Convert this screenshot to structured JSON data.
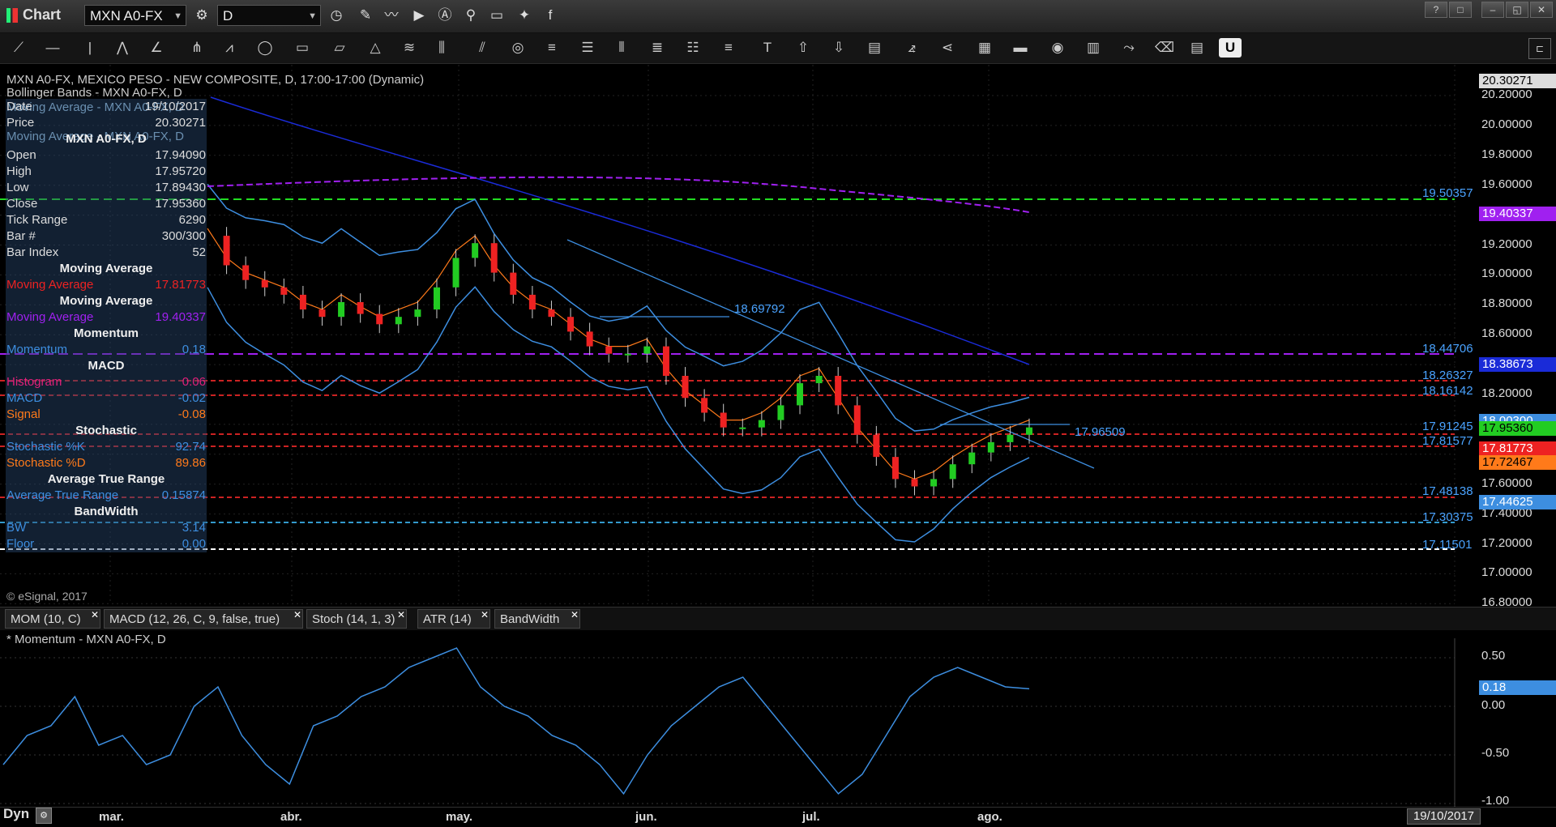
{
  "app": {
    "title": "Chart"
  },
  "toolbar": {
    "symbol": "MXN A0-FX",
    "interval": "D"
  },
  "window_buttons": [
    "?",
    "□",
    "–",
    "◱",
    "✕"
  ],
  "chart": {
    "title": "MXN A0-FX, MEXICO PESO - NEW COMPOSITE, D, 17:00-17:00 (Dynamic)",
    "bands_label": "Bollinger Bands - MXN A0-FX, D",
    "ma1_label": "Moving Average - MXN A0-FX, D",
    "ma2_label": "Moving Average - MXN A0-FX, D",
    "copyright": "© eSignal, 2017"
  },
  "info_panel": {
    "date": {
      "label": "Date",
      "value": "19/10/2017"
    },
    "price": {
      "label": "Price",
      "value": "20.30271"
    },
    "symbol_header": "MXN A0-FX, D",
    "open": {
      "label": "Open",
      "value": "17.94090"
    },
    "high": {
      "label": "High",
      "value": "17.95720"
    },
    "low": {
      "label": "Low",
      "value": "17.89430"
    },
    "close": {
      "label": "Close",
      "value": "17.95360"
    },
    "tick_range": {
      "label": "Tick Range",
      "value": "6290"
    },
    "bar_num": {
      "label": "Bar #",
      "value": "300/300"
    },
    "bar_index": {
      "label": "Bar Index",
      "value": "52"
    },
    "ma1_header": "Moving Average",
    "ma1": {
      "label": "Moving Average",
      "value": "17.81773"
    },
    "ma2_header": "Moving Average",
    "ma2": {
      "label": "Moving Average",
      "value": "19.40337"
    },
    "mom_header": "Momentum",
    "mom": {
      "label": "Momentum",
      "value": "0.18"
    },
    "macd_header": "MACD",
    "hist": {
      "label": "Histogram",
      "value": "0.06"
    },
    "macd": {
      "label": "MACD",
      "value": "-0.02"
    },
    "signal": {
      "label": "Signal",
      "value": "-0.08"
    },
    "stoch_header": "Stochastic",
    "stk": {
      "label": "Stochastic %K",
      "value": "92.74"
    },
    "std": {
      "label": "Stochastic %D",
      "value": "89.86"
    },
    "atr_header": "Average True Range",
    "atr": {
      "label": "Average True Range",
      "value": "0.15874"
    },
    "bw_header": "BandWidth",
    "bw": {
      "label": "BW",
      "value": "3.14"
    },
    "floor": {
      "label": "Floor",
      "value": "0.00"
    }
  },
  "price_axis": [
    "20.20000",
    "20.00000",
    "19.80000",
    "19.60000",
    "19.40000",
    "19.20000",
    "19.00000",
    "18.80000",
    "18.60000",
    "18.40000",
    "18.20000",
    "18.00000",
    "17.80000",
    "17.60000",
    "17.40000",
    "17.20000",
    "17.00000",
    "16.80000"
  ],
  "price_tags": {
    "top": "20.30271",
    "ma_slow": "19.40337",
    "band_mid": "18.38673",
    "band_up": "18.00300",
    "last": "17.95360",
    "ma_fast": "17.81773",
    "ma_orange": "17.72467",
    "band_low": "17.44625"
  },
  "levels": [
    "19.50357",
    "18.44706",
    "18.26327",
    "18.16142",
    "17.91245",
    "17.81577",
    "17.48138",
    "17.30375",
    "17.11501"
  ],
  "annotations": {
    "trend_high": "18.69792",
    "trend_low": "17.96509"
  },
  "tabs": [
    "MOM (10, C)",
    "MACD (12, 26, C, 9, false, true)",
    "Stoch (14, 1, 3)",
    "ATR (14)",
    "BandWidth"
  ],
  "momentum": {
    "title": "* Momentum - MXN A0-FX, D",
    "axis": [
      "0.50",
      "0.00",
      "-0.50",
      "-1.00"
    ],
    "tag": "0.18"
  },
  "x_axis": [
    "mar.",
    "abr.",
    "may.",
    "jun.",
    "jul.",
    "ago."
  ],
  "date_tag": "19/10/2017",
  "dyn_label": "Dyn",
  "colors": {
    "bull": "#22cc22",
    "bear": "#ee2222",
    "band": "#3d8ee0",
    "ma_slow": "#1a2bd8",
    "ma_purple": "#a020f0"
  },
  "chart_data": {
    "type": "line",
    "title": "MXN A0-FX, MEXICO PESO - NEW COMPOSITE, D, 17:00-17:00 (Dynamic)",
    "xlabel": "",
    "ylabel": "",
    "ylim": [
      16.8,
      20.3
    ],
    "x_categories": [
      "mar.",
      "abr.",
      "may.",
      "jun.",
      "jul.",
      "ago."
    ],
    "series": [
      {
        "values": [
          19.25,
          19.05,
          18.95,
          18.9,
          18.85,
          18.75,
          18.7,
          18.8,
          18.72,
          18.65,
          18.7,
          18.75,
          18.9,
          19.1,
          19.2,
          19.0,
          18.85,
          18.75,
          18.7,
          18.6,
          18.5,
          18.45,
          18.45,
          18.5,
          18.3,
          18.15,
          18.05,
          17.95,
          17.95,
          18.0,
          18.1,
          18.25,
          18.3,
          18.1,
          17.9,
          17.75,
          17.6,
          17.55,
          17.6,
          17.7,
          17.78,
          17.85,
          17.9,
          17.95
        ]
      }
    ],
    "momentum_values": [
      -0.6,
      -0.3,
      -0.2,
      0.1,
      -0.4,
      -0.3,
      -0.6,
      -0.5,
      0.0,
      0.2,
      -0.3,
      -0.6,
      -0.8,
      -0.2,
      -0.1,
      0.1,
      0.2,
      0.4,
      0.5,
      0.6,
      0.2,
      0.0,
      -0.1,
      -0.3,
      -0.4,
      -0.6,
      -0.9,
      -0.5,
      -0.2,
      0.0,
      0.2,
      0.3,
      0.0,
      -0.3,
      -0.6,
      -0.9,
      -0.7,
      -0.3,
      0.1,
      0.3,
      0.4,
      0.3,
      0.2,
      0.18
    ]
  }
}
